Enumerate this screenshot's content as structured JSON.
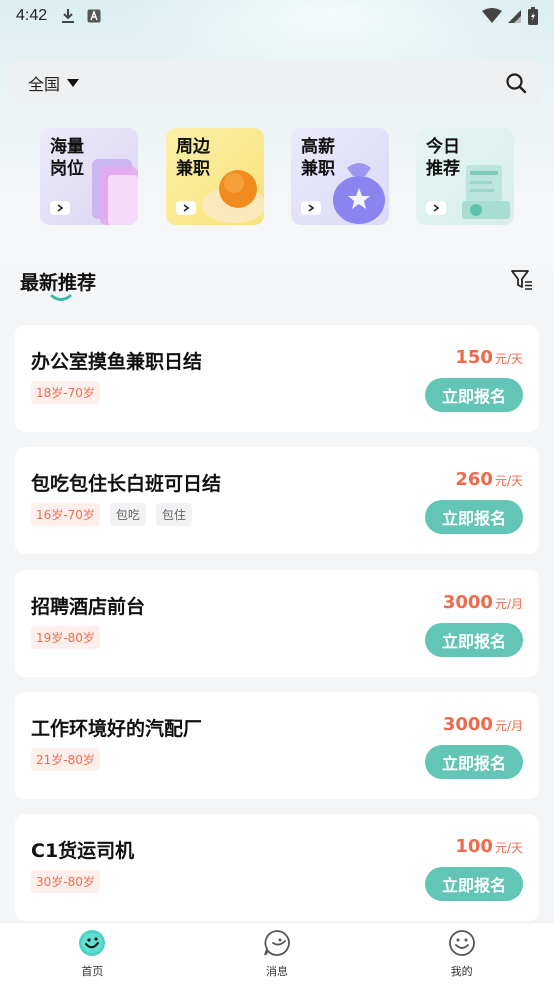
{
  "status_bar": {
    "time": "4:42"
  },
  "search": {
    "region": "全国"
  },
  "categories": [
    {
      "line1": "海量",
      "line2": "岗位"
    },
    {
      "line1": "周边",
      "line2": "兼职"
    },
    {
      "line1": "高薪",
      "line2": "兼职"
    },
    {
      "line1": "今日",
      "line2": "推荐"
    }
  ],
  "section": {
    "title": "最新推荐"
  },
  "apply_label": "立即报名",
  "jobs": [
    {
      "title": "办公室摸鱼兼职日结",
      "salary": "150",
      "unit": "元/天",
      "age": "18岁-70岁",
      "tags": []
    },
    {
      "title": "包吃包住长白班可日结",
      "salary": "260",
      "unit": "元/天",
      "age": "16岁-70岁",
      "tags": [
        "包吃",
        "包住"
      ]
    },
    {
      "title": "招聘酒店前台",
      "salary": "3000",
      "unit": "元/月",
      "age": "19岁-80岁",
      "tags": []
    },
    {
      "title": "工作环境好的汽配厂",
      "salary": "3000",
      "unit": "元/月",
      "age": "21岁-80岁",
      "tags": []
    },
    {
      "title": "C1货运司机",
      "salary": "100",
      "unit": "元/天",
      "age": "30岁-80岁",
      "tags": []
    }
  ],
  "tab_bar": {
    "home": "首页",
    "messages": "消息",
    "mine": "我的"
  },
  "colors": {
    "accent": "#63c5b5",
    "salary": "#ef6a4b"
  }
}
